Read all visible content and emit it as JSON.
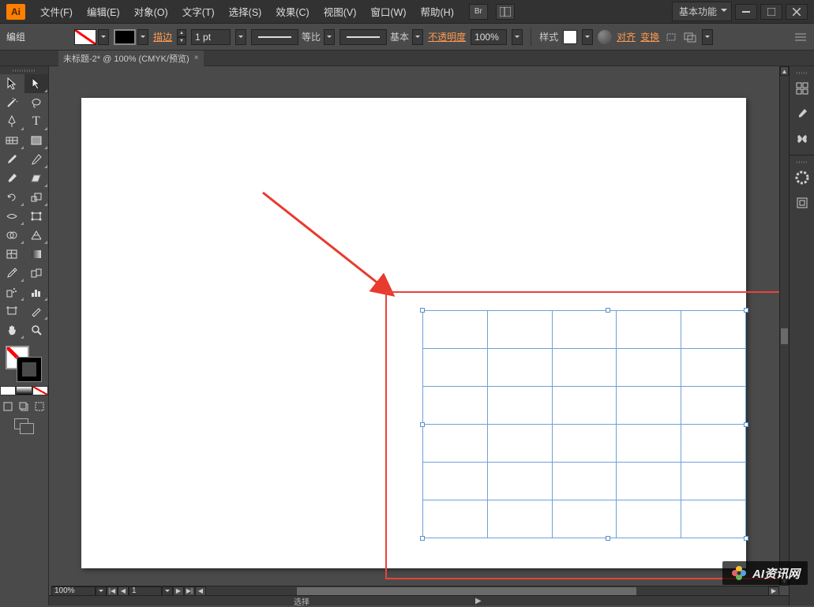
{
  "menu": {
    "items": [
      "文件(F)",
      "编辑(E)",
      "对象(O)",
      "文字(T)",
      "选择(S)",
      "效果(C)",
      "视图(V)",
      "窗口(W)",
      "帮助(H)"
    ],
    "workspace": "基本功能"
  },
  "control": {
    "context_label": "编组",
    "stroke_label": "描边",
    "stroke_weight": "1 pt",
    "brush_uniform": "等比",
    "brush_basic": "基本",
    "opacity_label": "不透明度",
    "opacity_value": "100%",
    "style_label": "样式",
    "align_label": "对齐",
    "transform_label": "变换"
  },
  "tab": {
    "title": "未标题-2* @ 100% (CMYK/预览)"
  },
  "status": {
    "zoom": "100%",
    "page": "1",
    "mode": "选择"
  },
  "wm": {
    "text": "AI资讯网"
  },
  "grid": {
    "rows": 6,
    "cols": 5
  }
}
